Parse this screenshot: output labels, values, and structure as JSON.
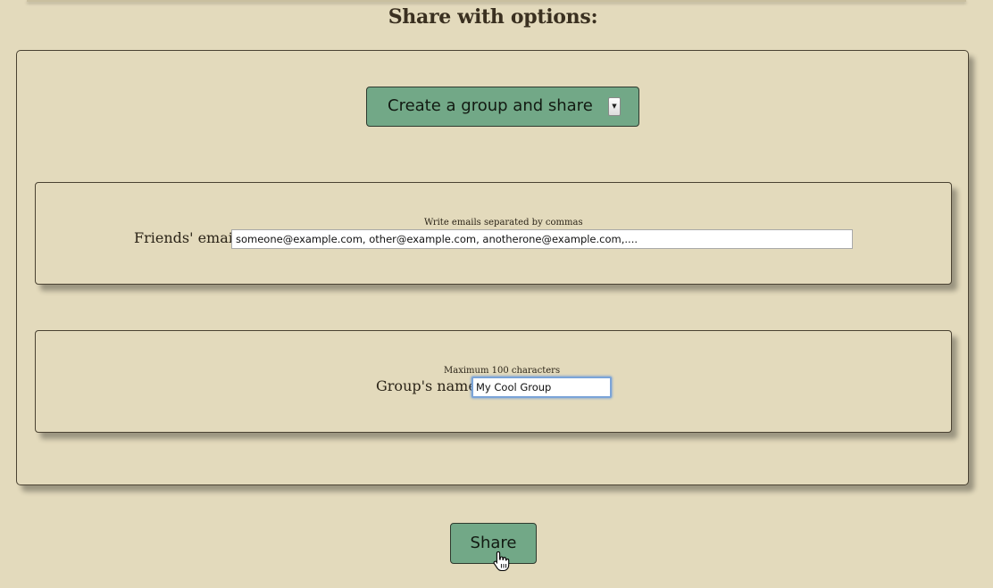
{
  "page": {
    "title": "Share with options:"
  },
  "share_mode": {
    "selected": "Create a group and share",
    "arrow_icon": "chevron-down-icon"
  },
  "friends_email": {
    "hint": "Write emails separated by commas",
    "label": "Friends' email:",
    "value": "someone@example.com, other@example.com, anotherone@example.com,...."
  },
  "group_name": {
    "hint": "Maximum 100 characters",
    "label": "Group's name:",
    "value": "My Cool Group"
  },
  "actions": {
    "share_label": "Share"
  },
  "colors": {
    "background": "#e3dabc",
    "button": "#72a887",
    "border": "#4a4232",
    "focus_ring": "#7ba4d8"
  }
}
